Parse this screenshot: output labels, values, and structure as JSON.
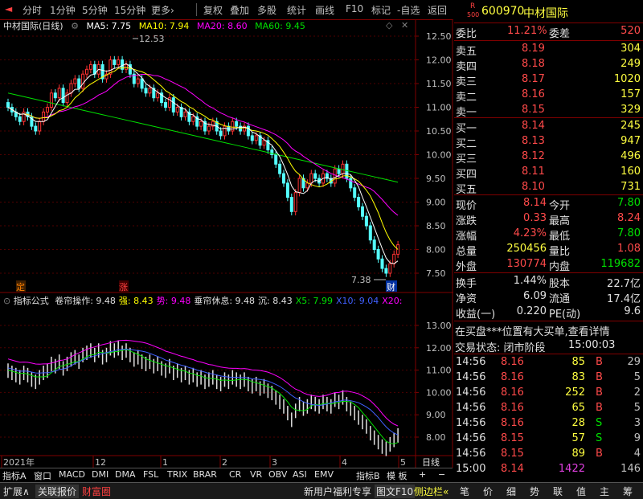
{
  "toolbar": {
    "items": [
      "分时",
      "1分钟",
      "5分钟",
      "15分钟",
      "更多›",
      "复权",
      "叠加",
      "多股",
      "统计",
      "画线",
      "F10",
      "标记",
      "-自选",
      "返回"
    ]
  },
  "chart": {
    "stock_label": "中材国际(日线)",
    "ma5": "MA5: 7.75",
    "ma10": "MA10: 7.94",
    "ma20": "MA20: 8.60",
    "ma60": "MA60: 9.45",
    "price_axis": [
      "12.50",
      "12.00",
      "11.50",
      "11.00",
      "10.50",
      "10.00",
      "9.50",
      "9.00",
      "8.50",
      "8.00",
      "7.50"
    ],
    "high_label": "12.53",
    "low_label": "7.38",
    "tag_ding": "定",
    "tag_zhang": "涨",
    "tag_cai": "财",
    "colors": {
      "ma5": "#ffffff",
      "ma10": "#ffff00",
      "ma20": "#ff00ff",
      "ma60": "#00e000",
      "up": "#ff3232",
      "down": "#54ffff"
    }
  },
  "indicator": {
    "name": "指标公式",
    "items": [
      {
        "label": "卷帘操作: 9.48",
        "color": "#e0e0e0"
      },
      {
        "label": "强: 8.43",
        "color": "#ffff00"
      },
      {
        "label": "势: 9.48",
        "color": "#ff00ff"
      },
      {
        "label": "垂帘休息: 9.48",
        "color": "#e0e0e0"
      },
      {
        "label": "沉: 8.43",
        "color": "#e0e0e0"
      },
      {
        "label": "X5: 7.99",
        "color": "#00e000"
      },
      {
        "label": "X10: 9.04",
        "color": "#4060ff"
      },
      {
        "label": "X20:",
        "color": "#ff00ff"
      }
    ],
    "axis": [
      "13.00",
      "12.00",
      "11.00",
      "10.00",
      "9.00",
      "8.00"
    ]
  },
  "xaxis": {
    "labels": [
      "2021年",
      "12",
      "1",
      "2",
      "3",
      "4",
      "5"
    ],
    "period": "日线"
  },
  "tabs": [
    "指标A",
    "窗口",
    "MACD",
    "DMI",
    "DMA",
    "FSL",
    "TRIX",
    "BRAR",
    "CR",
    "VR",
    "OBV",
    "ASI",
    "EMV",
    "指标B",
    "模 板",
    "+",
    "−"
  ],
  "statusbar": {
    "left": [
      "扩展∧",
      "关联报价",
      "财富圈"
    ],
    "mid": "新用户福利专享",
    "f10": "图文F10",
    "side": "侧边栏«",
    "right": [
      "笔",
      "价",
      "细",
      "势",
      "联",
      "值",
      "主",
      "筹"
    ]
  },
  "quote": {
    "code": "600970",
    "name": "中材国际",
    "r_badge": "R",
    "badge_num": "500",
    "weibi_label": "委比",
    "weibi": "11.21%",
    "weicha_label": "委差",
    "weicha": "520",
    "asks": [
      {
        "label": "卖五",
        "price": "8.19",
        "vol": "304"
      },
      {
        "label": "卖四",
        "price": "8.18",
        "vol": "249"
      },
      {
        "label": "卖三",
        "price": "8.17",
        "vol": "1020"
      },
      {
        "label": "卖二",
        "price": "8.16",
        "vol": "157"
      },
      {
        "label": "卖一",
        "price": "8.15",
        "vol": "329"
      }
    ],
    "bids": [
      {
        "label": "买一",
        "price": "8.14",
        "vol": "245"
      },
      {
        "label": "买二",
        "price": "8.13",
        "vol": "947"
      },
      {
        "label": "买三",
        "price": "8.12",
        "vol": "496"
      },
      {
        "label": "买四",
        "price": "8.11",
        "vol": "160"
      },
      {
        "label": "买五",
        "price": "8.10",
        "vol": "731"
      }
    ],
    "stats": [
      {
        "l1": "现价",
        "v1": "8.14",
        "c1": "red",
        "l2": "今开",
        "v2": "7.80",
        "c2": "green"
      },
      {
        "l1": "涨跌",
        "v1": "0.33",
        "c1": "red",
        "l2": "最高",
        "v2": "8.24",
        "c2": "red"
      },
      {
        "l1": "涨幅",
        "v1": "4.23%",
        "c1": "red",
        "l2": "最低",
        "v2": "7.80",
        "c2": "green"
      },
      {
        "l1": "总量",
        "v1": "250456",
        "c1": "yellow",
        "l2": "量比",
        "v2": "1.08",
        "c2": "red"
      },
      {
        "l1": "外盘",
        "v1": "130774",
        "c1": "red",
        "l2": "内盘",
        "v2": "119682",
        "c2": "green"
      }
    ],
    "fin": [
      {
        "l1": "换手",
        "v1": "1.44%",
        "l2": "股本",
        "v2": "22.7亿"
      },
      {
        "l1": "净资",
        "v1": "6.09",
        "l2": "流通",
        "v2": "17.4亿"
      },
      {
        "l1": "收益(一)",
        "v1": "0.220",
        "l2": "PE(动)",
        "v2": "9.6"
      }
    ],
    "notice": "在买盘***位置有大买单,查看详情",
    "trade_status_label": "交易状态: 闭市阶段",
    "trade_status_time": "15:00:03",
    "ticks": [
      {
        "t": "14:56",
        "p": "8.16",
        "v": "85",
        "s": "B",
        "n": "29"
      },
      {
        "t": "14:56",
        "p": "8.16",
        "v": "83",
        "s": "B",
        "n": "5"
      },
      {
        "t": "14:56",
        "p": "8.16",
        "v": "252",
        "s": "B",
        "n": "2"
      },
      {
        "t": "14:56",
        "p": "8.16",
        "v": "65",
        "s": "B",
        "n": "5"
      },
      {
        "t": "14:56",
        "p": "8.16",
        "v": "28",
        "s": "S",
        "n": "3"
      },
      {
        "t": "14:56",
        "p": "8.15",
        "v": "57",
        "s": "S",
        "n": "9"
      },
      {
        "t": "14:56",
        "p": "8.15",
        "v": "89",
        "s": "B",
        "n": "4"
      },
      {
        "t": "15:00",
        "p": "8.14",
        "v": "1422",
        "s": "",
        "n": "146"
      }
    ]
  }
}
